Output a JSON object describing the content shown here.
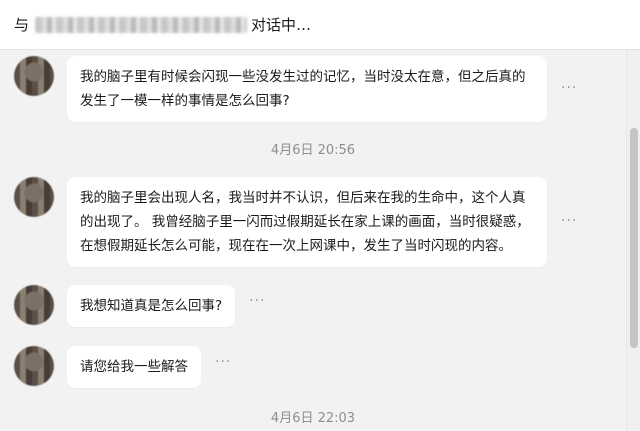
{
  "header": {
    "prefix": "与",
    "suffix": "对话中…"
  },
  "messages": [
    {
      "text": "我的脑子里有时候会闪现一些没发生过的记忆，当时没太在意，但之后真的\n发生了一模一样的事情是怎么回事?"
    },
    {
      "text": "我的脑子里会出现人名，我当时并不认识，但后来在我的生命中，这个人真\n的出现了。 我曾经脑子里一闪而过假期延长在家上课的画面，当时很疑惑，\n在想假期延长怎么可能，现在在一次上网课中，发生了当时闪现的内容。"
    },
    {
      "text": "我想知道真是怎么回事?"
    },
    {
      "text": "请您给我一些解答"
    }
  ],
  "timestamps": [
    "4月6日 20:56",
    "4月6日 22:03"
  ],
  "more_label": "···"
}
